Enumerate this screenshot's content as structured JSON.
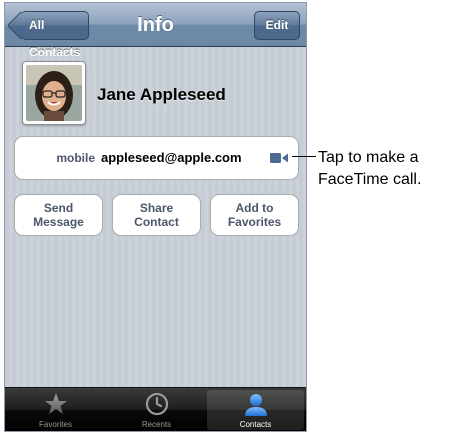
{
  "navbar": {
    "back_label": "All Contacts",
    "title": "Info",
    "edit_label": "Edit"
  },
  "contact": {
    "name": "Jane Appleseed",
    "photo_icon": "contact-photo"
  },
  "info": {
    "label": "mobile",
    "value": "appleseed@apple.com",
    "action_icon": "facetime-video-icon"
  },
  "actions": {
    "send_line1": "Send",
    "send_line2": "Message",
    "share_line1": "Share",
    "share_line2": "Contact",
    "add_line1": "Add to",
    "add_line2": "Favorites"
  },
  "tabbar": {
    "items": [
      {
        "label": "Favorites",
        "icon": "star-icon",
        "active": false
      },
      {
        "label": "Recents",
        "icon": "clock-icon",
        "active": false
      },
      {
        "label": "Contacts",
        "icon": "person-icon",
        "active": true
      }
    ]
  },
  "callout": {
    "line1": "Tap to make a",
    "line2": "FaceTime call."
  },
  "colors": {
    "navbar_blue": "#6d87a7",
    "button_text": "#4c566c",
    "active_tab": "#2f7fe0"
  }
}
